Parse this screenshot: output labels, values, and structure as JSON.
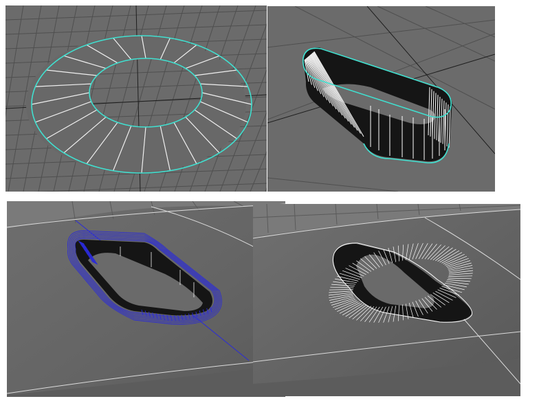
{
  "figure": {
    "panels": [
      {
        "name": "flat-ring-top-view",
        "caption": ""
      },
      {
        "name": "extruded-slot-band",
        "caption": ""
      },
      {
        "name": "slot-cut-into-surface-wireframe",
        "caption": ""
      },
      {
        "name": "slot-cut-into-surface-dense-mesh",
        "caption": ""
      }
    ]
  },
  "colors": {
    "viewport_bg": "#6b6b6b",
    "grid_line": "#4e4e4e",
    "grid_axis": "#1e1e1e",
    "surface_shade": "#686868",
    "selected_edge_cyan": "#40e0d0",
    "wire_white": "#ffffff",
    "wire_blue": "#2b2bd8",
    "interior_dark": "#151515"
  },
  "icons": {
    "mesh": "polygon-mesh-wireframe"
  }
}
